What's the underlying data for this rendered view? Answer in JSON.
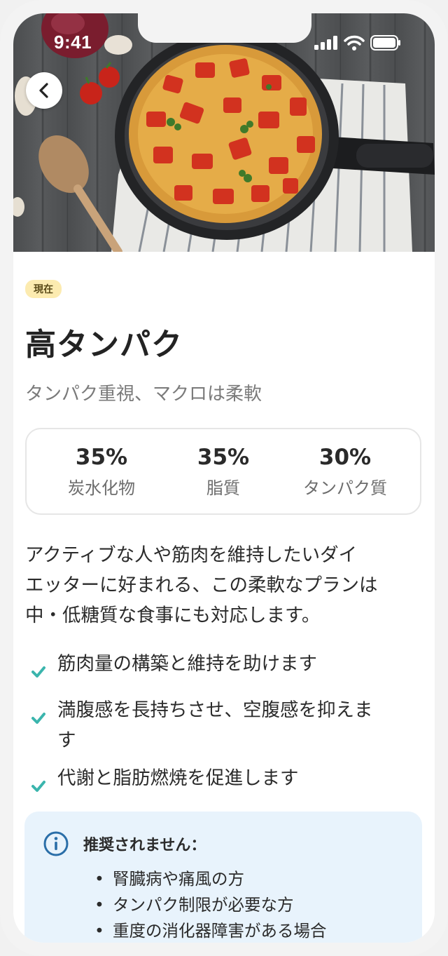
{
  "status_bar": {
    "time": "9:41"
  },
  "hero": {
    "image_icon": "frittata-pan-photo",
    "back_icon": "chevron-left-icon"
  },
  "badge": "現在",
  "plan": {
    "title": "高タンパク",
    "subtitle": "タンパク重視、マクロは柔軟"
  },
  "macros": [
    {
      "value": "35%",
      "label": "炭水化物"
    },
    {
      "value": "35%",
      "label": "脂質"
    },
    {
      "value": "30%",
      "label": "タンパク質"
    }
  ],
  "description": [
    "アクティブな人や筋肉を維持したいダイ",
    "エッターに好まれる、この柔軟なプランは",
    "中・低糖質な食事にも対応します。"
  ],
  "benefits": [
    {
      "lines": [
        "筋肉量の構築と維持を助けます"
      ]
    },
    {
      "lines": [
        "満腹感を長持ちさせ、空腹感を抑えま",
        "す"
      ]
    },
    {
      "lines": [
        "代謝と脂肪燃焼を促進します"
      ]
    }
  ],
  "colors": {
    "check": "#3bb5ad",
    "info": "#2a6ea8",
    "badge_bg": "#fcebb0",
    "notice_bg": "#e8f3fc"
  },
  "notice": {
    "title": "推奨されません：",
    "items": [
      "腎臓病や痛風の方",
      "タンパク制限が必要な方",
      "重度の消化器障害がある場合"
    ]
  }
}
